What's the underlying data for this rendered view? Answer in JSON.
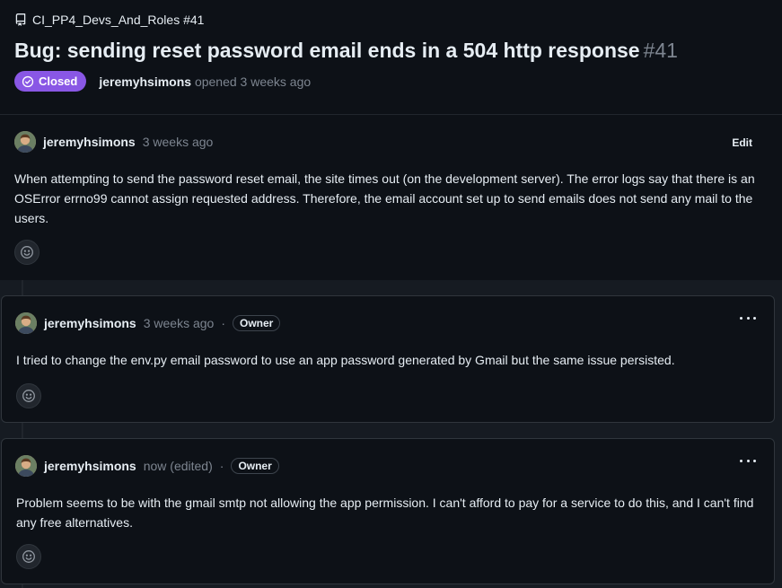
{
  "issue": {
    "repo_label": "CI_PP4_Devs_And_Roles #41",
    "title": "Bug: sending reset password email ends in a 504 http response",
    "number": "#41",
    "state": "Closed",
    "author": "jeremyhsimons",
    "opened_text": "opened 3 weeks ago"
  },
  "first_comment": {
    "author": "jeremyhsimons",
    "time": "3 weeks ago",
    "edit_label": "Edit",
    "body": "When attempting to send the password reset email, the site times out (on the development server). The error logs say that there is an OSError errno99 cannot assign requested address. Therefore, the email account set up to send emails does not send any mail to the users."
  },
  "comments": [
    {
      "author": "jeremyhsimons",
      "time": "3 weeks ago",
      "separator": "·",
      "badge": "Owner",
      "body": "I tried to change the env.py email password to use an app password generated by Gmail but the same issue persisted."
    },
    {
      "author": "jeremyhsimons",
      "time": "now (edited)",
      "separator": "·",
      "badge": "Owner",
      "body": "Problem seems to be with the gmail smtp not allowing the app permission. I can't afford to pay for a service to do this, and I can't find any free alternatives."
    }
  ],
  "colors": {
    "background": "#0d1117",
    "timeline": "#161b22",
    "closed_badge": "#8957e5",
    "muted_text": "#7d8590",
    "border": "#30363d"
  },
  "icons": {
    "repo": "repo-icon",
    "closed": "check-circle-icon",
    "reaction": "smiley-icon",
    "menu": "kebab-icon"
  }
}
